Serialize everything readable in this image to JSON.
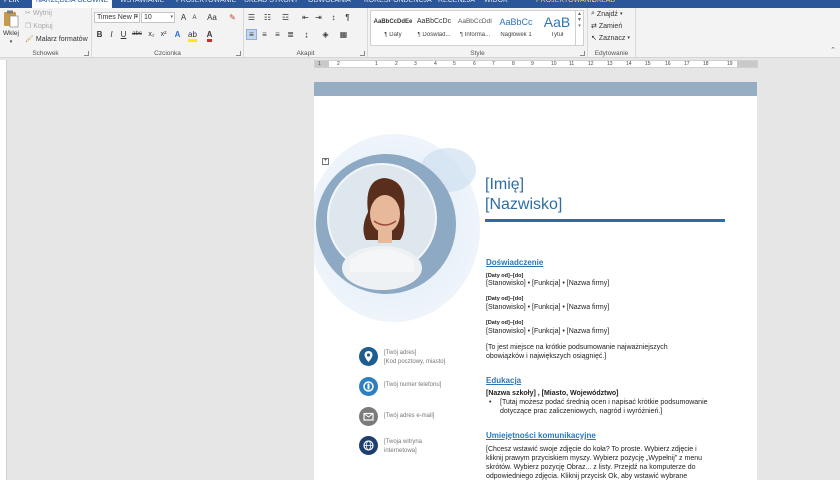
{
  "ribbon_tabs": [
    {
      "label": "PLIK"
    },
    {
      "label": "NARZĘDZIA GŁÓWNE"
    },
    {
      "label": "WSTAWIANIE"
    },
    {
      "label": "PROJEKTOWANIE"
    },
    {
      "label": "UKŁAD STRONY"
    },
    {
      "label": "ODWOŁANIA"
    },
    {
      "label": "KORESPONDENCJA"
    },
    {
      "label": "RECENZJA"
    },
    {
      "label": "WIDOK"
    },
    {
      "label": "PROJEKTOWANIE"
    },
    {
      "label": "UKŁAD"
    }
  ],
  "clipboard": {
    "paste_label": "Wklej",
    "cut_label": "Wytnij",
    "copy_label": "Kopiuj",
    "format_painter_label": "Malarz formatów",
    "group_label": "Schowek"
  },
  "font": {
    "font_name": "Times New F",
    "font_size": "10",
    "bold": "B",
    "italic": "I",
    "underline": "U",
    "strike": "abc",
    "subscript": "x₂",
    "superscript": "x²",
    "case": "Aa",
    "grow": "A",
    "shrink": "A",
    "group_label": "Czcionka"
  },
  "paragraph": {
    "group_label": "Akapit"
  },
  "styles": {
    "items": [
      {
        "sample": "AaBbCcDdEe",
        "name": "¶ Daty"
      },
      {
        "sample": "AaBbCcDc",
        "name": "¶ Dośwlad..."
      },
      {
        "sample": "AaBbCcDdI",
        "name": "¶ Informa..."
      },
      {
        "sample": "AaBbCc",
        "name": "Nagłówek 1"
      },
      {
        "sample": "AaB",
        "name": "Tytuł"
      }
    ],
    "group_label": "Style"
  },
  "editing": {
    "find_label": "Znajdź",
    "replace_label": "Zamień",
    "select_label": "Zaznacz",
    "group_label": "Edytowanie"
  },
  "ruler_marks": [
    "1",
    "2",
    "1",
    "2",
    "3",
    "4",
    "5",
    "6",
    "7",
    "8",
    "9",
    "10",
    "11",
    "12",
    "13",
    "14",
    "15",
    "16",
    "17",
    "18",
    "19"
  ],
  "colors": {
    "accent": "#2e6da4",
    "heading": "#2e75b6",
    "band": "#95aec4",
    "ribbon_tab": "#2b579a"
  },
  "resume": {
    "first_name": "[Imię]",
    "last_name": "[Nazwisko]",
    "experience": {
      "heading": "Doświadczenie",
      "entries": [
        {
          "dates": "[Daty od]–[do]",
          "line": "[Stanowisko] • [Funkcja] • [Nazwa firmy]"
        },
        {
          "dates": "[Daty od]–[do]",
          "line": "[Stanowisko] • [Funkcja] • [Nazwa firmy]"
        },
        {
          "dates": "[Daty od]–[do]",
          "line": "[Stanowisko] • [Funkcja] • [Nazwa firmy]"
        }
      ],
      "summary_1": "[To jest miejsce na krótkie podsumowanie najważniejszych",
      "summary_2": "obowiązków i największych osiągnięć.]"
    },
    "education": {
      "heading": "Edukacja",
      "school": "[Nazwa szkoły] , [Miasto, Województwo]",
      "bullet_1": "[Tutaj możesz podać średnią ocen i napisać krótkie podsumowanie",
      "bullet_2": "dotyczące prac zaliczeniowych, nagród i wyróżnień.]"
    },
    "communication": {
      "heading": "Umiejętności komunikacyjne",
      "line_1": "[Chcesz wstawić swoje zdjęcie do koła? To proste. Wybierz zdjęcie i",
      "line_2": "kliknij prawym przyciskiem myszy. Wybierz pozycję „Wypełnij” z menu",
      "line_3": "skrótów. Wybierz pozycję Obraz... z listy. Przejdź na komputerze do",
      "line_4": "odpowiedniego zdjęcia. Kliknij przycisk Ok, aby wstawić wybrane"
    },
    "contact": {
      "address_1": "[Twój adres]",
      "address_2": "[Kod pocztowy, miasto]",
      "phone": "[Twój numer telefonu]",
      "email": "[Twój adres e-mail]",
      "website_1": "[Twoja witryna",
      "website_2": "internetowa]"
    }
  }
}
